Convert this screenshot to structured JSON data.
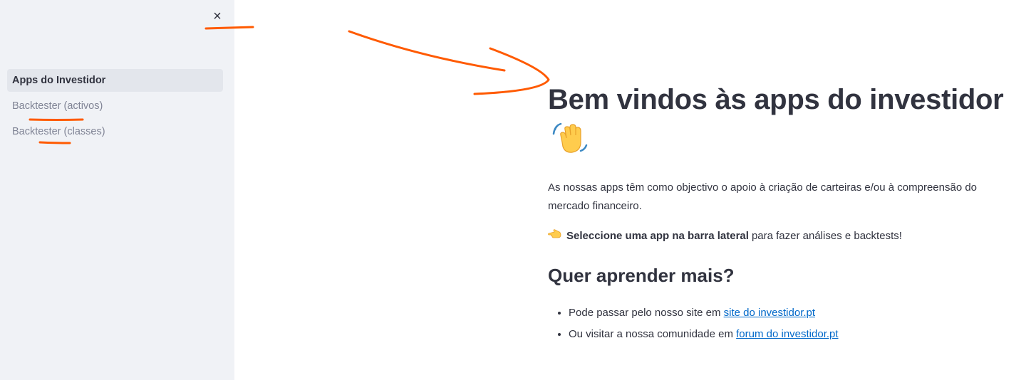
{
  "sidebar": {
    "close_label": "×",
    "items": [
      {
        "label": "Apps do Investidor",
        "active": true
      },
      {
        "label": "Backtester (activos)",
        "active": false
      },
      {
        "label": "Backtester (classes)",
        "active": false
      }
    ]
  },
  "main": {
    "title": "Bem vindos às apps do investidor",
    "title_emoji": "waving-hand-icon",
    "intro": "As nossas apps têm como objectivo o apoio à criação de carteiras e/ou à compreensão do mercado financeiro.",
    "cta_emoji": "pointing-hand-icon",
    "cta_bold": "Seleccione uma app na barra lateral",
    "cta_rest": "para fazer análises e backtests!",
    "subtitle": "Quer aprender mais?",
    "links": [
      {
        "prefix": "Pode passar pelo nosso site em ",
        "link_text": "site do investidor.pt"
      },
      {
        "prefix": "Ou visitar a nossa comunidade em ",
        "link_text": "forum do investidor.pt"
      }
    ]
  },
  "colors": {
    "sidebar_bg": "#f0f2f6",
    "active_item_bg": "#e3e6ec",
    "text": "#31333f",
    "muted_text": "#808495",
    "link": "#0068c9",
    "annotation": "#ff5a00"
  }
}
